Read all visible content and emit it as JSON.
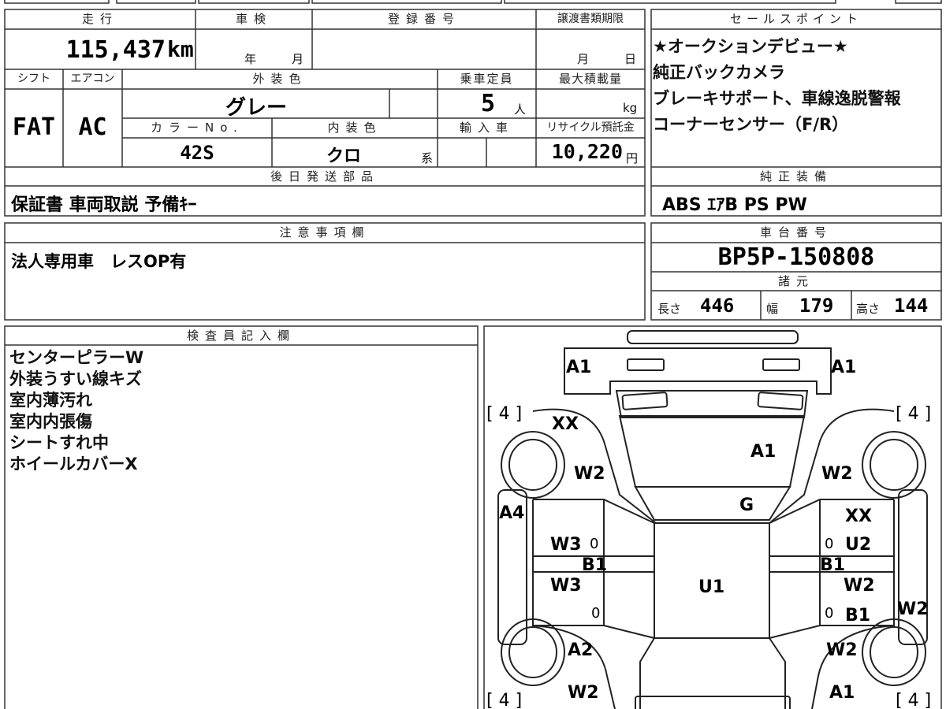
{
  "headers": {
    "mileage": "走行",
    "shaken": "車検",
    "registration": "登録番号",
    "transfer_deadline": "譲渡書類期限",
    "sales_point": "セールスポイント",
    "shift": "シフト",
    "aircon": "エアコン",
    "exterior_color": "外装色",
    "capacity": "乗車定員",
    "max_load": "最大積載量",
    "color_no": "カラーNo.",
    "interior_color": "内装色",
    "import": "輸入車",
    "recycle_fee": "リサイクル預託金",
    "later_parts": "後日発送部品",
    "std_equipment": "純正装備",
    "caution": "注意事項欄",
    "chassis_no": "車台番号",
    "specs": "諸元",
    "inspector": "検査員記入欄"
  },
  "vehicle": {
    "mileage": "115,437",
    "mileage_unit": "km",
    "shaken_year_unit": "年",
    "shaken_month_unit": "月",
    "deadline_month_unit": "月",
    "deadline_day_unit": "日",
    "shift": "FAT",
    "aircon": "AC",
    "exterior_color": "グレー",
    "capacity": "5",
    "capacity_unit": "人",
    "max_load_unit": "kg",
    "color_no": "42S",
    "interior_color": "クロ",
    "interior_suffix": "系",
    "recycle_fee": "10,220",
    "recycle_unit": "円",
    "later_parts": "保証書 車両取説 予備ｷｰ",
    "std_equipment": "ABS ｴｱB PS PW",
    "caution": "法人専用車　レスOP有",
    "chassis_no": "BP5P-150808",
    "length_label": "長さ",
    "length": "446",
    "width_label": "幅",
    "width": "179",
    "height_label": "高さ",
    "height": "144"
  },
  "sales_points": [
    "★オークションデビュー★",
    "純正バックカメラ",
    "ブレーキサポート、車線逸脱警報",
    "コーナーセンサー（F/R）"
  ],
  "inspector_notes": [
    "センターピラーW",
    "外装うすい線キズ",
    "室内薄汚れ",
    "室内内張傷",
    "シートすれ中",
    "ホイールカバーX"
  ],
  "diagram": {
    "tire_fl": "[ 4 ]",
    "tire_fr": "[ 4 ]",
    "tire_rl": "[ 4 ]",
    "tire_rr": "[ 4 ]",
    "marks": {
      "bumper_left": "A1",
      "bumper_right": "A1",
      "fender_fl_upper": "XX",
      "fender_fl": "W2",
      "fender_fr": "W2",
      "hood": "A1",
      "windshield": "G",
      "side_left": "A4",
      "door_fl": "W3",
      "door_fl_zero": "0",
      "pillar_left": "B1",
      "door_rl": "W3",
      "door_rl_zero": "0",
      "roof": "U1",
      "fr_xx": "XX",
      "door_fr_zero": "0",
      "door_fr": "U2",
      "pillar_right": "B1",
      "door_rr": "W2",
      "door_rr_zero": "0",
      "door_rr_b1": "B1",
      "side_right": "W2",
      "quarter_rl": "A2",
      "quarter_rr": "W2",
      "rear_left": "W2",
      "rear_right": "A1"
    }
  }
}
